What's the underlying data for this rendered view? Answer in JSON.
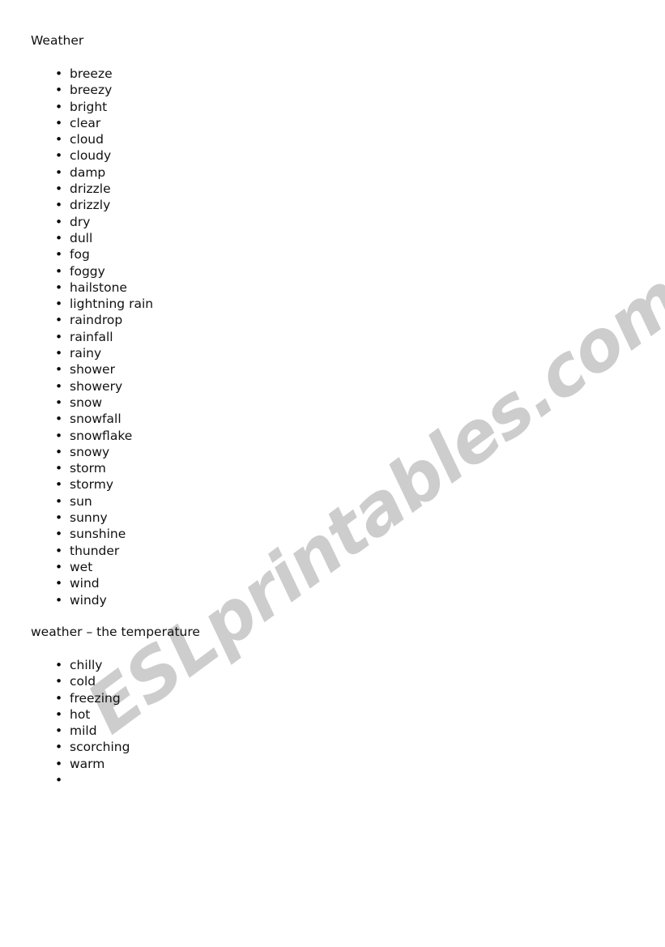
{
  "document": {
    "title": "Weather",
    "background_color": "#ffffff",
    "text_color": "#111111"
  },
  "watermark": {
    "text": "ESLprintables.com",
    "color": "#cdcdcd",
    "angle_degrees": -36.5
  },
  "sections": [
    {
      "heading": "Weather",
      "bullet_glyph": "•",
      "words": [
        "breeze",
        "breezy",
        "bright",
        "clear",
        "cloud",
        "cloudy",
        "damp",
        "drizzle",
        "drizzly",
        "dry",
        "dull",
        "fog",
        "foggy",
        "hailstone",
        "lightning rain",
        "raindrop",
        "rainfall",
        "rainy",
        "shower",
        "showery",
        "snow",
        "snowfall",
        "snowflake",
        "snowy",
        "storm",
        "stormy",
        "sun",
        "sunny",
        "sunshine",
        "thunder",
        "wet",
        "wind",
        "windy"
      ]
    },
    {
      "heading": "weather – the temperature",
      "bullet_glyph": "•",
      "words": [
        "chilly",
        "cold",
        "freezing",
        "hot",
        "mild",
        "scorching",
        "warm",
        ""
      ]
    }
  ]
}
